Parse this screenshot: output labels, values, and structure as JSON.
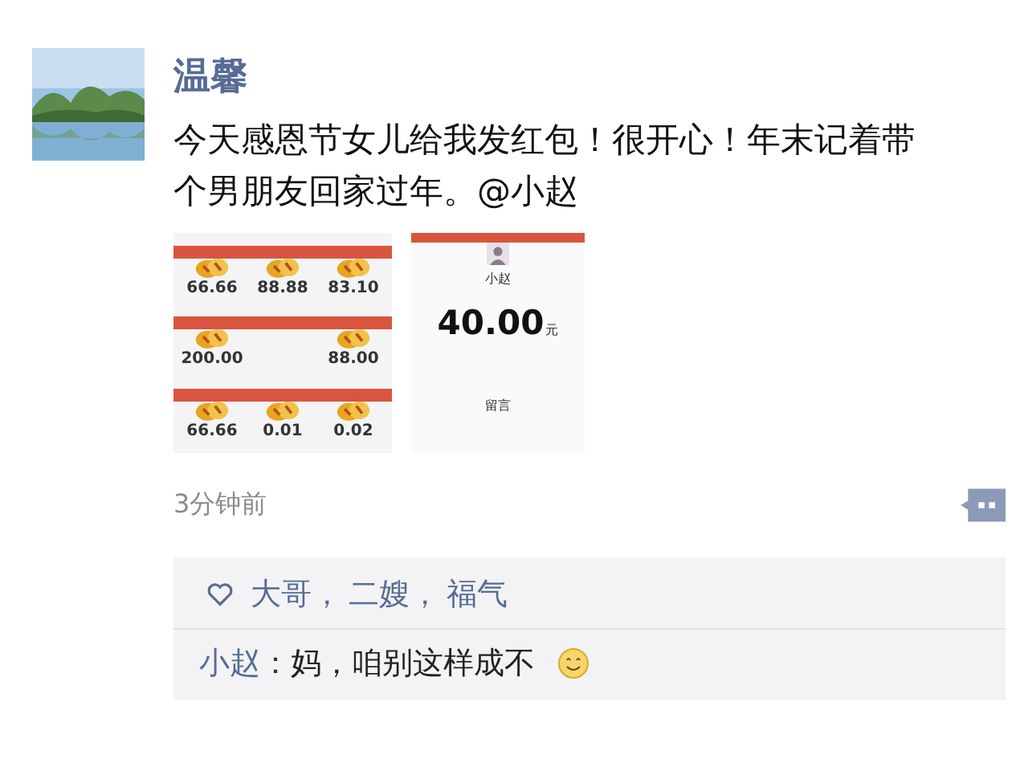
{
  "post": {
    "author": "温馨",
    "text": "今天感恩节女儿给我发红包！很开心！年末记着带个男朋友回家过年。@小赵",
    "time": "3分钟前"
  },
  "images": [
    {
      "kind": "packet-grid",
      "rows": [
        {
          "amounts": [
            "66.66",
            "88.88",
            "83.10"
          ]
        },
        {
          "amounts": [
            "200.00",
            "88.00"
          ]
        },
        {
          "amounts": [
            "66.66",
            "0.01",
            "0.02"
          ]
        }
      ]
    },
    {
      "kind": "packet-detail",
      "sender": "小赵",
      "amount": "40.00",
      "unit": "元",
      "action": "留言"
    }
  ],
  "likes": [
    {
      "name": "大哥",
      "sep": "，"
    },
    {
      "name": "二嫂",
      "sep": "，"
    },
    {
      "name": "福气"
    }
  ],
  "comments": [
    {
      "author": "小赵",
      "colon": "：",
      "text": "妈，咱别这样成不",
      "emoji": true
    }
  ]
}
